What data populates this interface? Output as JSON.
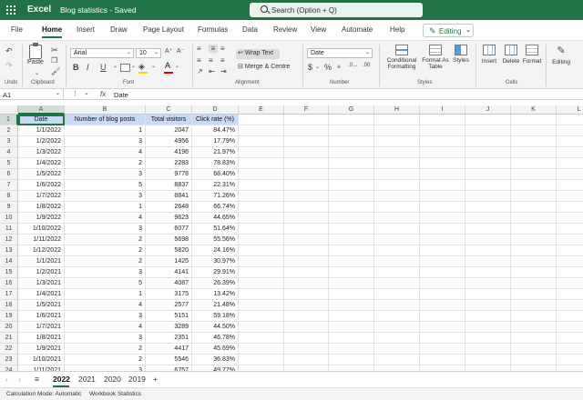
{
  "titlebar": {
    "app_name": "Excel",
    "doc_title": "Blog statistics  -  Saved",
    "search_placeholder": "Search (Option + Q)",
    "color": "#217346"
  },
  "menu": {
    "items": [
      "File",
      "Home",
      "Insert",
      "Draw",
      "Page Layout",
      "Formulas",
      "Data",
      "Review",
      "View",
      "Automate",
      "Help"
    ],
    "active": "Home",
    "editing_label": "Editing"
  },
  "ribbon": {
    "undo_label": "Undo",
    "clipboard": {
      "paste_label": "Paste",
      "group_label": "Clipboard"
    },
    "font": {
      "name": "Arial",
      "size": "10",
      "group_label": "Font",
      "bold": "B",
      "italic": "I",
      "underline": "U"
    },
    "alignment": {
      "wrap_text": "Wrap Text",
      "merge_center": "Merge & Centre",
      "group_label": "Alignment"
    },
    "number": {
      "format": "Date",
      "group_label": "Number"
    },
    "styles": {
      "conditional": "Conditional",
      "conditional2": "Formatting",
      "format_as": "Format As",
      "format_as2": "Table",
      "styles_label": "Styles",
      "group_label": "Styles"
    },
    "cells": {
      "insert": "Insert",
      "delete": "Delete",
      "format": "Format",
      "group_label": "Cells"
    },
    "editing": {
      "label": "Editing"
    }
  },
  "formula_bar": {
    "cell_ref": "A1",
    "fx": "fx",
    "content": "Date"
  },
  "columns": [
    "A",
    "B",
    "C",
    "D",
    "E",
    "F",
    "G",
    "H",
    "I",
    "J",
    "K",
    "L"
  ],
  "header_row": [
    "Date",
    "Number of blog posts",
    "Total visitors",
    "Click rate (%)"
  ],
  "rows": [
    [
      "1/1/2022",
      "1",
      "2047",
      "84.47%"
    ],
    [
      "1/2/2022",
      "3",
      "4956",
      "17.79%"
    ],
    [
      "1/3/2022",
      "4",
      "4196",
      "21.97%"
    ],
    [
      "1/4/2022",
      "2",
      "2283",
      "78.83%"
    ],
    [
      "1/5/2022",
      "3",
      "9778",
      "68.40%"
    ],
    [
      "1/6/2022",
      "5",
      "8837",
      "22.31%"
    ],
    [
      "1/7/2022",
      "3",
      "8841",
      "71.26%"
    ],
    [
      "1/8/2022",
      "1",
      "2648",
      "66.74%"
    ],
    [
      "1/9/2022",
      "4",
      "9623",
      "44.65%"
    ],
    [
      "1/10/2022",
      "3",
      "6077",
      "51.64%"
    ],
    [
      "1/11/2022",
      "2",
      "5698",
      "55.56%"
    ],
    [
      "1/12/2022",
      "2",
      "5820",
      "24.16%"
    ],
    [
      "1/1/2021",
      "2",
      "1425",
      "30.97%"
    ],
    [
      "1/2/2021",
      "3",
      "4141",
      "29.91%"
    ],
    [
      "1/3/2021",
      "5",
      "4087",
      "26.39%"
    ],
    [
      "1/4/2021",
      "1",
      "3175",
      "13.42%"
    ],
    [
      "1/5/2021",
      "4",
      "2577",
      "21.48%"
    ],
    [
      "1/6/2021",
      "3",
      "5151",
      "59.18%"
    ],
    [
      "1/7/2021",
      "4",
      "3289",
      "44.50%"
    ],
    [
      "1/8/2021",
      "3",
      "2351",
      "46.78%"
    ],
    [
      "1/9/2021",
      "2",
      "4417",
      "45.69%"
    ],
    [
      "1/10/2021",
      "2",
      "5546",
      "36.83%"
    ],
    [
      "1/11/2021",
      "3",
      "6757",
      "49.77%"
    ]
  ],
  "tabs": {
    "items": [
      "2022",
      "2021",
      "2020",
      "2019"
    ],
    "active": "2022",
    "add": "+"
  },
  "status": {
    "calc_mode": "Calculation Mode: Automatic",
    "workbook_stats": "Workbook Statistics"
  }
}
